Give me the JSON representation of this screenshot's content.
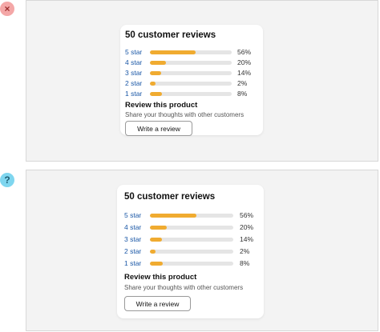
{
  "variants": [
    {
      "marker": {
        "symbol": "×",
        "meaning": "incorrect",
        "icon": "close-icon",
        "color": "#f4a7a7"
      },
      "card": {
        "title": "50 customer reviews",
        "ratings": [
          {
            "label": "5 star",
            "percent_text": "56%",
            "fill": 0.56
          },
          {
            "label": "4 star",
            "percent_text": "20%",
            "fill": 0.2
          },
          {
            "label": "3 star",
            "percent_text": "14%",
            "fill": 0.14
          },
          {
            "label": "2 star",
            "percent_text": "2%",
            "fill": 0.07
          },
          {
            "label": "1 star",
            "percent_text": "8%",
            "fill": 0.15
          }
        ],
        "review_heading": "Review this product",
        "review_subtext": "Share your thoughts with other customers",
        "button_label": "Write a review"
      }
    },
    {
      "marker": {
        "symbol": "?",
        "meaning": "unknown",
        "icon": "question-icon",
        "color": "#7fd6ef"
      },
      "card": {
        "title": "50 customer reviews",
        "ratings": [
          {
            "label": "5 star",
            "percent_text": "56%",
            "fill": 0.56
          },
          {
            "label": "4 star",
            "percent_text": "20%",
            "fill": 0.2
          },
          {
            "label": "3 star",
            "percent_text": "14%",
            "fill": 0.14
          },
          {
            "label": "2 star",
            "percent_text": "2%",
            "fill": 0.07
          },
          {
            "label": "1 star",
            "percent_text": "8%",
            "fill": 0.15
          }
        ],
        "review_heading": "Review this product",
        "review_subtext": "Share your thoughts with other customers",
        "button_label": "Write a review"
      }
    }
  ],
  "colors": {
    "bar_fill": "#f0ab30",
    "bar_track": "#e5e5e5",
    "star_link": "#1a57a6",
    "panel_background": "#f3f3f3"
  }
}
